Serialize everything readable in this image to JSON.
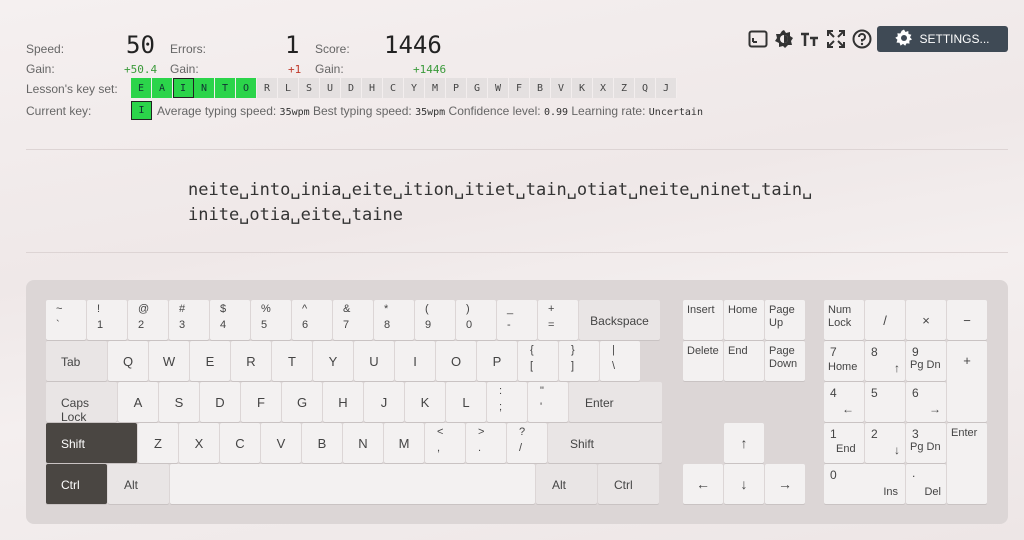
{
  "stats": {
    "speed_label": "Speed:",
    "speed_value": "50",
    "errors_label": "Errors:",
    "errors_value": "1",
    "score_label": "Score:",
    "score_value": "1446",
    "gain_label": "Gain:",
    "speed_gain": "+50.4",
    "errors_gain": "+1",
    "score_gain": "+1446"
  },
  "toolbar": {
    "icons": [
      "window-icon",
      "theme-icon",
      "font-size-icon",
      "fullscreen-icon",
      "help-icon"
    ],
    "settings_label": "SETTINGS..."
  },
  "keyset": {
    "label": "Lesson's key set:",
    "keys": [
      "E",
      "A",
      "I",
      "N",
      "T",
      "O",
      "R",
      "L",
      "S",
      "U",
      "D",
      "H",
      "C",
      "Y",
      "M",
      "P",
      "G",
      "W",
      "F",
      "B",
      "V",
      "K",
      "X",
      "Z",
      "Q",
      "J"
    ],
    "included_count": 6,
    "current": "I"
  },
  "current_key": {
    "label": "Current key:",
    "key": "I",
    "avg_label": "Average typing speed:",
    "avg_value": "35wpm",
    "best_label": "Best typing speed:",
    "best_value": "35wpm",
    "conf_label": "Confidence level:",
    "conf_value": "0.99",
    "rate_label": "Learning rate:",
    "rate_value": "Uncertain"
  },
  "lesson": {
    "line1": "neite␣into␣inia␣eite␣ition␣itiet␣tain␣otiat␣neite␣ninet␣tain␣",
    "line2": "inite␣otia␣eite␣taine"
  },
  "keyboard": {
    "row1": [
      [
        "~",
        "`"
      ],
      [
        "!",
        "1"
      ],
      [
        "@",
        "2"
      ],
      [
        "#",
        "3"
      ],
      [
        "$",
        "4"
      ],
      [
        "%",
        "5"
      ],
      [
        "^",
        "6"
      ],
      [
        "&",
        "7"
      ],
      [
        "*",
        "8"
      ],
      [
        "(",
        "9"
      ],
      [
        ")",
        "0"
      ],
      [
        "_",
        "-"
      ],
      [
        "+",
        "="
      ]
    ],
    "backspace": "Backspace",
    "tab": "Tab",
    "row2": [
      "Q",
      "W",
      "E",
      "R",
      "T",
      "Y",
      "U",
      "I",
      "O",
      "P"
    ],
    "row2sym": [
      [
        "{",
        "["
      ],
      [
        "}",
        "]"
      ],
      [
        "|",
        "\\"
      ]
    ],
    "caps": "Caps Lock",
    "row3": [
      "A",
      "S",
      "D",
      "F",
      "G",
      "H",
      "J",
      "K",
      "L"
    ],
    "row3sym": [
      [
        ":",
        ";"
      ],
      [
        "\"",
        "'"
      ]
    ],
    "enter": "Enter",
    "shift": "Shift",
    "row4": [
      "Z",
      "X",
      "C",
      "V",
      "B",
      "N",
      "M"
    ],
    "row4sym": [
      [
        "<",
        ","
      ],
      [
        ">",
        "."
      ],
      [
        "?",
        "/"
      ]
    ],
    "ctrl": "Ctrl",
    "alt": "Alt",
    "nav": {
      "insert": "Insert",
      "home": "Home",
      "pageup": "Page Up",
      "delete": "Delete",
      "end": "End",
      "pagedown": "Page Down"
    },
    "arrows": {
      "up": "↑",
      "left": "←",
      "down": "↓",
      "right": "→"
    },
    "numpad": {
      "numlock": "Num Lock",
      "div": "/",
      "mul": "×",
      "minus": "−",
      "plus": "+",
      "enter": "Enter",
      "n7": "7",
      "n7s": "Home",
      "n8": "8",
      "n8s": "↑",
      "n9": "9",
      "n9s": "Pg Dn",
      "n4": "4",
      "n4s": "←",
      "n5": "5",
      "n6": "6",
      "n6s": "→",
      "n1": "1",
      "n1s": "End",
      "n2": "2",
      "n2s": "↓",
      "n3": "3",
      "n3s": "Pg Dn",
      "n0": "0",
      "n0s": "Ins",
      "dot": ".",
      "dots": "Del"
    }
  }
}
